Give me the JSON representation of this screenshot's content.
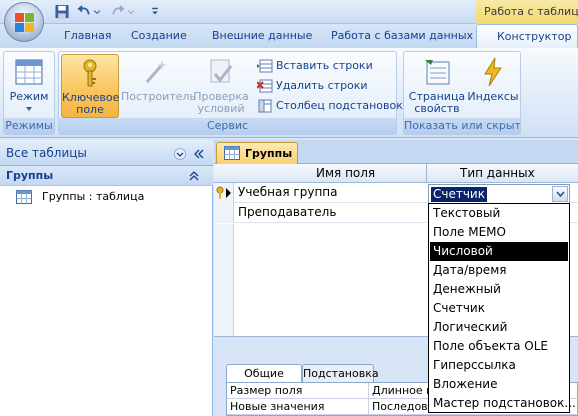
{
  "titlebar": {
    "contextual_title": "Работа с таблица"
  },
  "tabs": {
    "home": "Главная",
    "create": "Создание",
    "external": "Внешние данные",
    "database": "Работа с базами данных",
    "design": "Конструктор"
  },
  "ribbon": {
    "mode_group": {
      "label": "Режимы",
      "view_button": "Режим"
    },
    "service_group": {
      "label": "Сервис",
      "primary_key_line1": "Ключевое",
      "primary_key_line2": "поле",
      "builder": "Построитель",
      "check_line1": "Проверка",
      "check_line2": "условий",
      "insert_rows": "Вставить строки",
      "delete_rows": "Удалить строки",
      "lookup_column": "Столбец  подстановок"
    },
    "show_group": {
      "label": "Показать или скрыть",
      "property_sheet_line1": "Страница",
      "property_sheet_line2": "свойств",
      "indexes": "Индексы"
    }
  },
  "nav": {
    "title": "Все таблицы",
    "group": "Группы",
    "item": "Группы : таблица"
  },
  "document": {
    "tab": "Группы",
    "columns": {
      "field_name": "Имя поля",
      "data_type": "Тип данных"
    },
    "rows": [
      {
        "field": "Учебная группа",
        "type": "Счетчик",
        "primary_key": true
      },
      {
        "field": "Преподаватель",
        "type": ""
      }
    ]
  },
  "properties": {
    "tabs": [
      "Общие",
      "Подстановка"
    ],
    "rows": [
      {
        "key": "Размер поля",
        "value": "Длинное ц"
      },
      {
        "key": "Новые значения",
        "value": "Последова"
      }
    ]
  },
  "dropdown": {
    "value": "Счетчик",
    "options": [
      "Текстовый",
      "Поле MEMO",
      "Числовой",
      "Дата/время",
      "Денежный",
      "Счетчик",
      "Логический",
      "Поле объекта OLE",
      "Гиперссылка",
      "Вложение",
      "Мастер подстановок..."
    ],
    "highlighted": "Числовой"
  },
  "colors": {
    "accent": "#15428b",
    "ribbon_bg": "#dde9f8",
    "pressed": "#f9c966",
    "selection": "#0a246a"
  }
}
